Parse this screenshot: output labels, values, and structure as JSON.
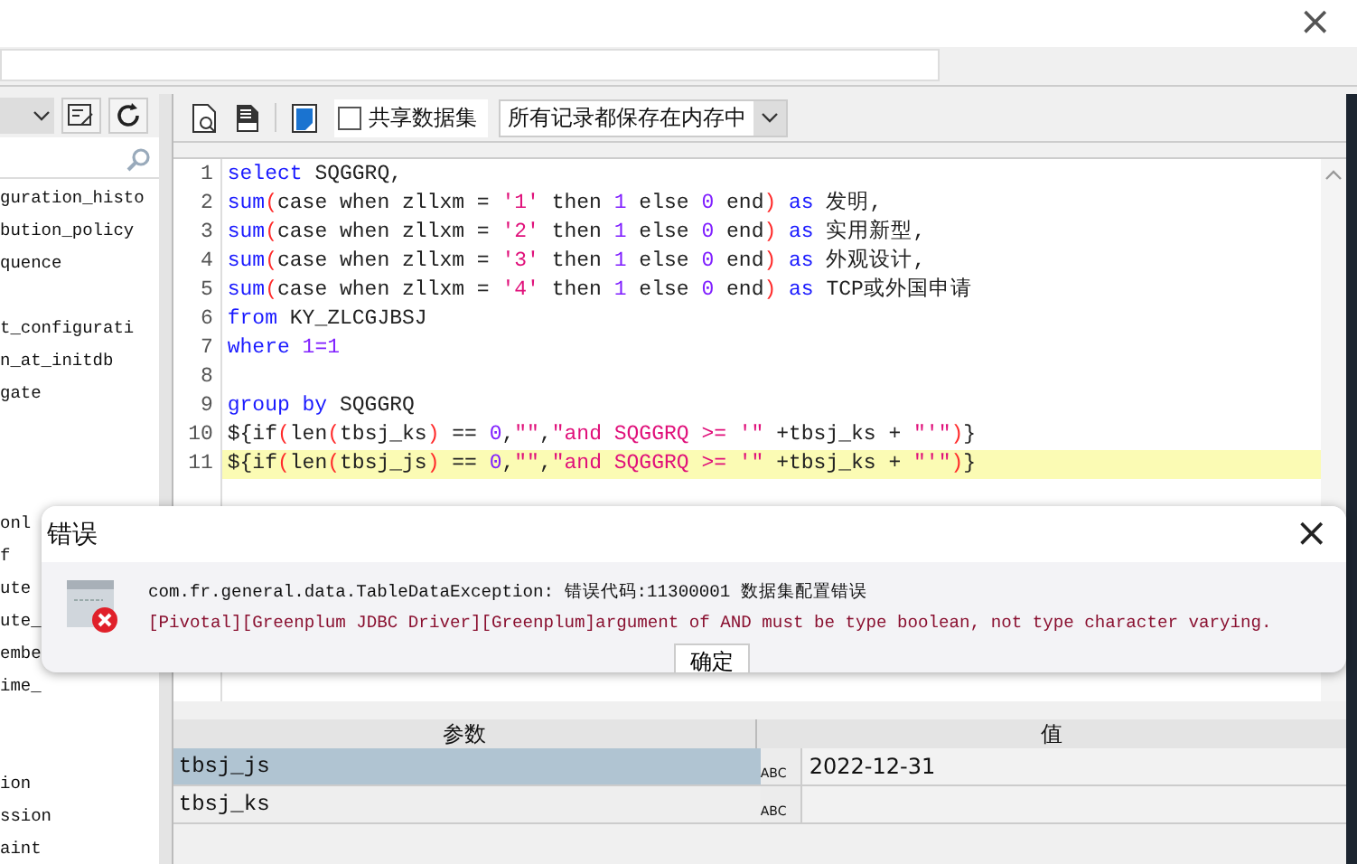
{
  "close_label": "×",
  "left_panel": {
    "groups": [
      [
        "guration_histo",
        "bution_policy",
        "quence"
      ],
      [
        "t_configurati",
        "n_at_initdb",
        "gate"
      ],
      [
        "onl",
        "f",
        "ute",
        "ute_",
        "embe",
        "ime_"
      ],
      [
        "ion",
        "ssion",
        "aint"
      ]
    ]
  },
  "toolbar": {
    "share_checkbox": {
      "label": "共享数据集",
      "checked": false
    },
    "storage_select": {
      "value": "所有记录都保存在内存中"
    }
  },
  "editor": {
    "lines": [
      {
        "number": "1",
        "highlighted": false,
        "tokens": [
          {
            "kind": "keyword",
            "text": "select"
          },
          {
            "kind": "plain",
            "text": " SQGGRQ,"
          }
        ]
      },
      {
        "number": "2",
        "highlighted": false,
        "tokens": [
          {
            "kind": "keyword",
            "text": "sum"
          },
          {
            "kind": "paren",
            "text": "("
          },
          {
            "kind": "plain",
            "text": "case when zllxm = "
          },
          {
            "kind": "string",
            "text": "'1'"
          },
          {
            "kind": "plain",
            "text": " then "
          },
          {
            "kind": "number",
            "text": "1"
          },
          {
            "kind": "plain",
            "text": " else "
          },
          {
            "kind": "number",
            "text": "0"
          },
          {
            "kind": "plain",
            "text": " end"
          },
          {
            "kind": "paren",
            "text": ")"
          },
          {
            "kind": "keyword",
            "text": " as"
          },
          {
            "kind": "plain",
            "text": " 发明,"
          }
        ]
      },
      {
        "number": "3",
        "highlighted": false,
        "tokens": [
          {
            "kind": "keyword",
            "text": "sum"
          },
          {
            "kind": "paren",
            "text": "("
          },
          {
            "kind": "plain",
            "text": "case when zllxm = "
          },
          {
            "kind": "string",
            "text": "'2'"
          },
          {
            "kind": "plain",
            "text": " then "
          },
          {
            "kind": "number",
            "text": "1"
          },
          {
            "kind": "plain",
            "text": " else "
          },
          {
            "kind": "number",
            "text": "0"
          },
          {
            "kind": "plain",
            "text": " end"
          },
          {
            "kind": "paren",
            "text": ")"
          },
          {
            "kind": "keyword",
            "text": " as"
          },
          {
            "kind": "plain",
            "text": " 实用新型,"
          }
        ]
      },
      {
        "number": "4",
        "highlighted": false,
        "tokens": [
          {
            "kind": "keyword",
            "text": "sum"
          },
          {
            "kind": "paren",
            "text": "("
          },
          {
            "kind": "plain",
            "text": "case when zllxm = "
          },
          {
            "kind": "string",
            "text": "'3'"
          },
          {
            "kind": "plain",
            "text": " then "
          },
          {
            "kind": "number",
            "text": "1"
          },
          {
            "kind": "plain",
            "text": " else "
          },
          {
            "kind": "number",
            "text": "0"
          },
          {
            "kind": "plain",
            "text": " end"
          },
          {
            "kind": "paren",
            "text": ")"
          },
          {
            "kind": "keyword",
            "text": " as"
          },
          {
            "kind": "plain",
            "text": " 外观设计,"
          }
        ]
      },
      {
        "number": "5",
        "highlighted": false,
        "tokens": [
          {
            "kind": "keyword",
            "text": "sum"
          },
          {
            "kind": "paren",
            "text": "("
          },
          {
            "kind": "plain",
            "text": "case when zllxm = "
          },
          {
            "kind": "string",
            "text": "'4'"
          },
          {
            "kind": "plain",
            "text": " then "
          },
          {
            "kind": "number",
            "text": "1"
          },
          {
            "kind": "plain",
            "text": " else "
          },
          {
            "kind": "number",
            "text": "0"
          },
          {
            "kind": "plain",
            "text": " end"
          },
          {
            "kind": "paren",
            "text": ")"
          },
          {
            "kind": "keyword",
            "text": " as"
          },
          {
            "kind": "plain",
            "text": " TCP或外国申请"
          }
        ]
      },
      {
        "number": "6",
        "highlighted": false,
        "tokens": [
          {
            "kind": "keyword",
            "text": "from"
          },
          {
            "kind": "plain",
            "text": " KY_ZLCGJBSJ"
          }
        ]
      },
      {
        "number": "7",
        "highlighted": false,
        "tokens": [
          {
            "kind": "keyword",
            "text": "where"
          },
          {
            "kind": "number",
            "text": " 1=1"
          }
        ]
      },
      {
        "number": "8",
        "highlighted": false
      },
      {
        "number": "9",
        "highlighted": false,
        "tokens": [
          {
            "kind": "keyword",
            "text": "group by"
          },
          {
            "kind": "plain",
            "text": " SQGGRQ"
          }
        ]
      },
      {
        "number": "10",
        "highlighted": false,
        "tokens": [
          {
            "kind": "plain",
            "text": "${if"
          },
          {
            "kind": "paren",
            "text": "("
          },
          {
            "kind": "plain",
            "text": "len"
          },
          {
            "kind": "paren",
            "text": "("
          },
          {
            "kind": "plain",
            "text": "tbsj_ks"
          },
          {
            "kind": "paren",
            "text": ")"
          },
          {
            "kind": "plain",
            "text": " == "
          },
          {
            "kind": "number",
            "text": "0"
          },
          {
            "kind": "plain",
            "text": ","
          },
          {
            "kind": "string",
            "text": "\"\""
          },
          {
            "kind": "plain",
            "text": ","
          },
          {
            "kind": "string",
            "text": "\"and SQGGRQ >= '\""
          },
          {
            "kind": "plain",
            "text": " +tbsj_ks + "
          },
          {
            "kind": "string",
            "text": "\"'\""
          },
          {
            "kind": "paren",
            "text": ")"
          },
          {
            "kind": "plain",
            "text": "}"
          }
        ]
      },
      {
        "number": "11",
        "highlighted": true,
        "tokens": [
          {
            "kind": "plain",
            "text": "${if"
          },
          {
            "kind": "paren",
            "text": "("
          },
          {
            "kind": "plain",
            "text": "len"
          },
          {
            "kind": "paren",
            "text": "("
          },
          {
            "kind": "plain",
            "text": "tbsj_js"
          },
          {
            "kind": "paren",
            "text": ")"
          },
          {
            "kind": "plain",
            "text": " == "
          },
          {
            "kind": "number",
            "text": "0"
          },
          {
            "kind": "plain",
            "text": ","
          },
          {
            "kind": "string",
            "text": "\"\""
          },
          {
            "kind": "plain",
            "text": ","
          },
          {
            "kind": "string",
            "text": "\"and SQGGRQ >= '\""
          },
          {
            "kind": "plain",
            "text": " +tbsj_ks + "
          },
          {
            "kind": "string",
            "text": "\"'\""
          },
          {
            "kind": "paren",
            "text": ")"
          },
          {
            "kind": "plain",
            "text": "}"
          }
        ]
      }
    ]
  },
  "parameters": {
    "columns": [
      "参数",
      "值"
    ],
    "rows": [
      {
        "name": "tbsj_js",
        "type": "ABC",
        "value": "2022-12-31",
        "selected": true
      },
      {
        "name": "tbsj_ks",
        "type": "ABC",
        "selected": false
      }
    ]
  },
  "error_dialog": {
    "title": "错误",
    "close": "×",
    "message": "com.fr.general.data.TableDataException: 错误代码:11300001 数据集配置错误",
    "detail": "[Pivotal][Greenplum JDBC Driver][Greenplum]argument of AND must be type boolean, not type character varying.",
    "button": "确定"
  }
}
